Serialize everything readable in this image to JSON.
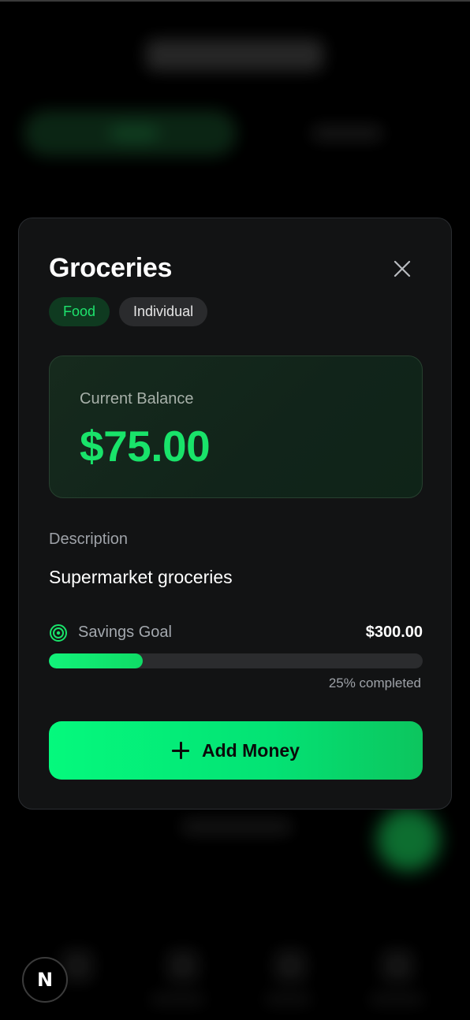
{
  "modal": {
    "title": "Groceries",
    "tags": [
      "Food",
      "Individual"
    ],
    "balance": {
      "label": "Current Balance",
      "amount": "$75.00"
    },
    "description": {
      "label": "Description",
      "text": "Supermarket groceries"
    },
    "savings_goal": {
      "label": "Savings Goal",
      "amount": "$300.00",
      "progress_fraction": 0.25,
      "progress_text": "25% completed"
    },
    "add_button_label": "Add Money"
  },
  "dev_badge_letter": "N",
  "colors": {
    "accent_green": "#19e36a",
    "modal_bg": "#121314",
    "page_bg": "#000000"
  }
}
